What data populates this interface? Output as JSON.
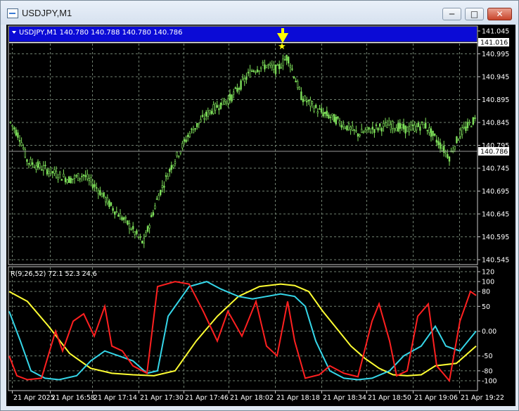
{
  "window": {
    "title": "USDJPY,M1",
    "buttons": {
      "minimize": "─",
      "maximize": "□",
      "close": "✕"
    }
  },
  "main_chart": {
    "header": "USDJPY,M1  140.780 140.788 140.780 140.786",
    "price_labels": [
      "141.045",
      "140.995",
      "140.945",
      "140.895",
      "140.845",
      "140.795",
      "140.745",
      "140.695",
      "140.645",
      "140.595",
      "140.545"
    ],
    "highlight_line": "141.016",
    "current_price": "140.786",
    "colors": {
      "background": "#000000",
      "candle": "#7ee05a",
      "header_bar": "#0b0bd6",
      "arrow": "#ffff00",
      "grid": "#6f7f6f"
    }
  },
  "indicator": {
    "label": "R(9,26,52) 72.1 52.3 24.6",
    "scale_labels": [
      "120",
      "100",
      "80",
      "50",
      "0.00",
      "-50",
      "-80",
      "-100"
    ],
    "series": [
      {
        "value": "72.1",
        "color": "#ff2020"
      },
      {
        "value": "52.3",
        "color": "#35d6e8"
      },
      {
        "value": "24.6",
        "color": "#ffff33"
      }
    ]
  },
  "time_axis": [
    "21 Apr 2025",
    "21 Apr 16:58",
    "21 Apr 17:14",
    "21 Apr 17:30",
    "21 Apr 17:46",
    "21 Apr 18:02",
    "21 Apr 18:18",
    "21 Apr 18:34",
    "21 Apr 18:50",
    "21 Apr 19:06",
    "21 Apr 19:22"
  ]
}
